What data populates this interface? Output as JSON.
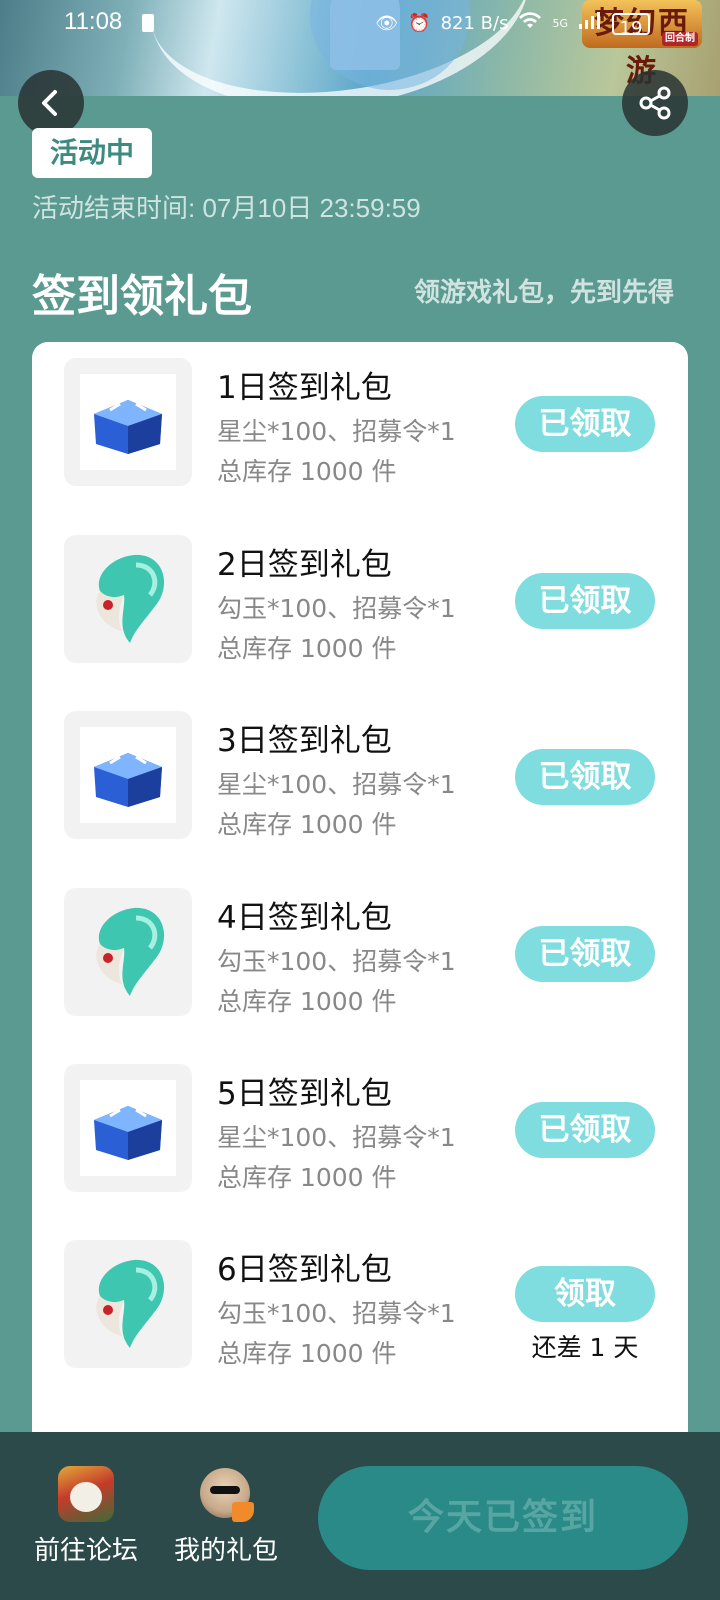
{
  "status_bar": {
    "time": "11:08",
    "net_speed": "821\nB/s",
    "network": "5G",
    "battery": "19"
  },
  "banner": {
    "logo_text": "梦幻西游",
    "logo_sub": "回合制"
  },
  "activity": {
    "badge": "活动中",
    "end_time": "活动结束时间: 07月10日 23:59:59"
  },
  "section": {
    "title": "签到领礼包",
    "subtitle": "领游戏礼包，先到先得"
  },
  "gifts": [
    {
      "title": "1日签到礼包",
      "desc": "星尘*100、招募令*1",
      "stock": "总库存 1000 件",
      "button": "已领取",
      "icon": "blue-chest-icon"
    },
    {
      "title": "2日签到礼包",
      "desc": "勾玉*100、招募令*1",
      "stock": "总库存 1000 件",
      "button": "已领取",
      "icon": "jade-magatama-icon"
    },
    {
      "title": "3日签到礼包",
      "desc": "星尘*100、招募令*1",
      "stock": "总库存 1000 件",
      "button": "已领取",
      "icon": "blue-chest-icon"
    },
    {
      "title": "4日签到礼包",
      "desc": "勾玉*100、招募令*1",
      "stock": "总库存 1000 件",
      "button": "已领取",
      "icon": "jade-magatama-icon"
    },
    {
      "title": "5日签到礼包",
      "desc": "星尘*100、招募令*1",
      "stock": "总库存 1000 件",
      "button": "已领取",
      "icon": "blue-chest-icon"
    },
    {
      "title": "6日签到礼包",
      "desc": "勾玉*100、招募令*1",
      "stock": "总库存 1000 件",
      "button": "领取",
      "remain": "还差 1 天",
      "icon": "jade-magatama-icon"
    }
  ],
  "bottom_bar": {
    "forum_label": "前往论坛",
    "my_gifts_label": "我的礼包",
    "signed_button": "今天已签到"
  },
  "colors": {
    "page_bg": "#5a9a90",
    "accent": "#7fdde0",
    "bottom_bar": "#2c4a4a",
    "signed_button": "#2a8a88"
  }
}
